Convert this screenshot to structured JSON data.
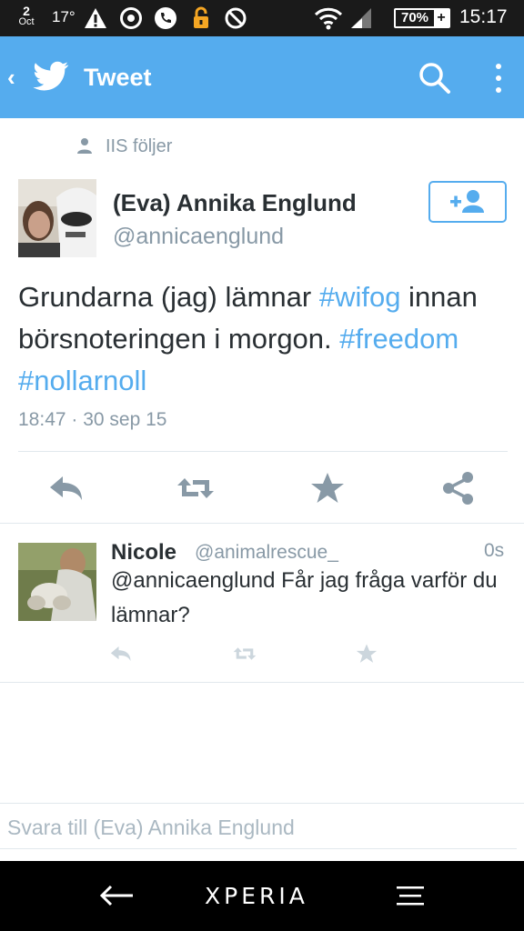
{
  "status_bar": {
    "date_day": "2",
    "date_month": "Oct",
    "temperature": "17°",
    "battery": "70%",
    "time": "15:17",
    "icons": [
      "warning-icon",
      "circle-dot-icon",
      "phone-icon",
      "lock-icon",
      "no-sync-icon",
      "wifi-icon",
      "signal-icon",
      "battery-icon"
    ]
  },
  "app_bar": {
    "back_glyph": "‹",
    "title": "Tweet",
    "icons": [
      "twitter-bird-icon",
      "search-icon",
      "more-vertical-icon"
    ]
  },
  "tweet": {
    "social_context": "IIS följer",
    "author_name": "(Eva) Annika Englund",
    "author_handle": "@annicaenglund",
    "text_segments": [
      {
        "text": "Grundarna (jag) lämnar ",
        "tag": false
      },
      {
        "text": "#wifog",
        "tag": true
      },
      {
        "text": " innan börsnoteringen i morgon. ",
        "tag": false
      },
      {
        "text": "#freedom",
        "tag": true
      },
      {
        "text": " ",
        "tag": false
      },
      {
        "text": "#nollarnoll",
        "tag": true
      }
    ],
    "timestamp": "18:47 · 30 sep 15",
    "actions": [
      "reply-icon",
      "retweet-icon",
      "favorite-icon",
      "share-icon"
    ]
  },
  "reply": {
    "name": "Nicole",
    "handle": "@animalrescue_",
    "time": "0s",
    "text": "@annicaenglund Får jag fråga varför du lämnar?",
    "actions": [
      "reply-icon",
      "retweet-icon",
      "favorite-icon"
    ]
  },
  "composer": {
    "placeholder": "Svara till (Eva) Annika Englund",
    "value": ""
  },
  "nav_bar": {
    "brand": "XPERIA",
    "icons": [
      "back-arrow-icon",
      "menu-icon"
    ]
  },
  "colors": {
    "accent": "#55acee",
    "text": "#292f33",
    "muted": "#8899a6",
    "divider": "#e1e8ed",
    "status_bar": "#1a1a1a"
  }
}
